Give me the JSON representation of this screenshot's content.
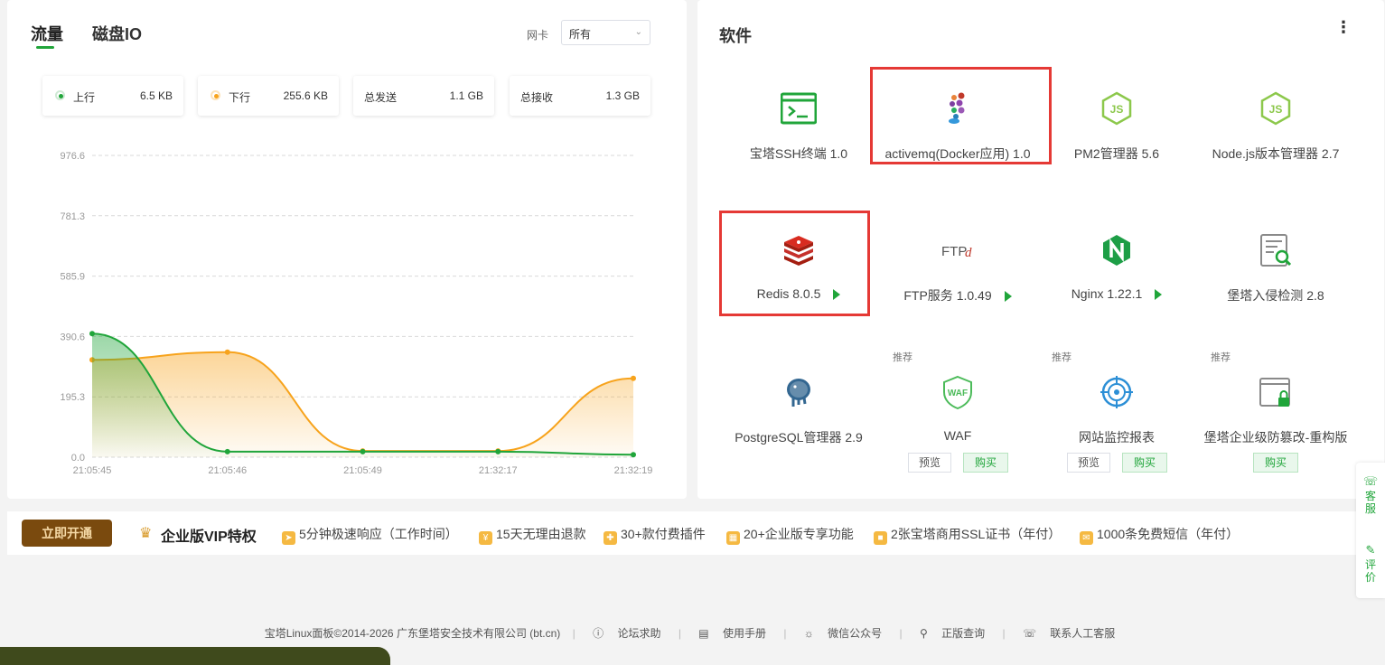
{
  "traffic": {
    "tabs": [
      "流量",
      "磁盘IO"
    ],
    "nic_label": "网卡",
    "nic_value": "所有",
    "stats": [
      {
        "label": "上行",
        "value": "6.5 KB",
        "dot_color": "#20a53a"
      },
      {
        "label": "下行",
        "value": "255.6 KB",
        "dot_color": "#f7a31c"
      },
      {
        "label": "总发送",
        "value": "1.1 GB"
      },
      {
        "label": "总接收",
        "value": "1.3 GB"
      }
    ]
  },
  "chart_data": {
    "type": "area",
    "x": [
      "21:05:45",
      "21:05:46",
      "21:05:49",
      "21:32:17",
      "21:32:19"
    ],
    "ylim": [
      0,
      976.6
    ],
    "yticks": [
      "976.6",
      "781.3",
      "585.9",
      "390.6",
      "195.3",
      "0.0"
    ],
    "grid": true,
    "series": [
      {
        "key": "up",
        "color": "#20a53a",
        "values": [
          400,
          18,
          18,
          18,
          8
        ]
      },
      {
        "key": "down",
        "color": "#f7a31c",
        "values": [
          315,
          340,
          20,
          20,
          255
        ]
      }
    ]
  },
  "software": {
    "title": "软件",
    "more_icon": "⋮",
    "items": [
      {
        "name": "宝塔SSH终端 1.0",
        "icon": "terminal-icon"
      },
      {
        "name": "activemq(Docker应用) 1.0",
        "icon": "activemq-icon"
      },
      {
        "name": "PM2管理器 5.6",
        "icon": "nodejs-icon"
      },
      {
        "name": "Node.js版本管理器 2.7",
        "icon": "nodejs-icon"
      },
      {
        "name": "Redis 8.0.5",
        "icon": "redis-icon"
      },
      {
        "name": "FTP服务 1.0.49",
        "icon": "ftp-icon"
      },
      {
        "name": "Nginx 1.22.1",
        "icon": "nginx-icon"
      },
      {
        "name": "堡塔入侵检测 2.8",
        "icon": "intrusion-detect-icon"
      },
      {
        "name": "PostgreSQL管理器 2.9",
        "icon": "postgresql-icon"
      },
      {
        "name": "WAF",
        "icon": "waf-icon"
      },
      {
        "name": "网站监控报表",
        "icon": "monitor-icon"
      },
      {
        "name": "堡塔企业级防篡改-重构版",
        "icon": "tamper-proof-icon"
      }
    ],
    "recommend_label": "推荐",
    "preview_label": "预览",
    "buy_label": "购买"
  },
  "vip": {
    "button": "立即开通",
    "title": "企业版VIP特权",
    "features": [
      "5分钟极速响应（工作时间）",
      "15天无理由退款",
      "30+款付费插件",
      "20+企业版专享功能",
      "2张宝塔商用SSL证书（年付）",
      "1000条免费短信（年付）"
    ]
  },
  "footer": {
    "copyright": "宝塔Linux面板©2014-2026 广东堡塔安全技术有限公司 (bt.cn)",
    "links": [
      "论坛求助",
      "使用手册",
      "微信公众号",
      "正版查询",
      "联系人工客服"
    ]
  },
  "float_bar": {
    "service": "客服",
    "review": "评价"
  }
}
